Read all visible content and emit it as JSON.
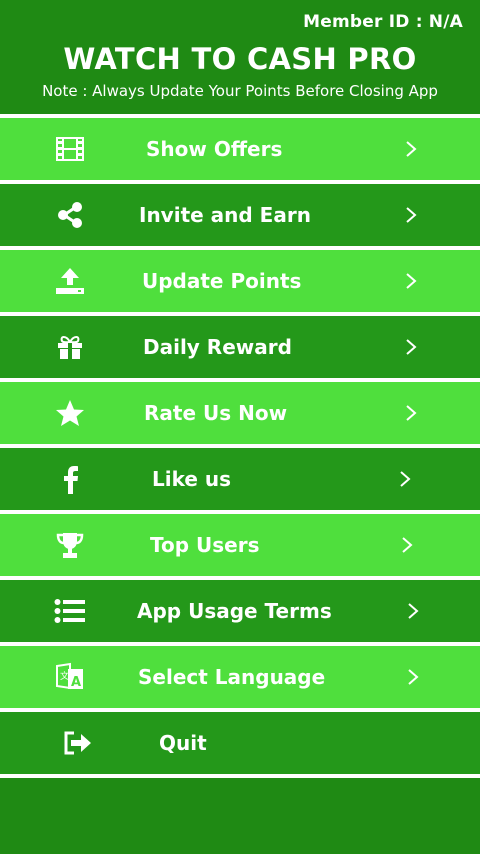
{
  "header": {
    "member_id": "Member ID : N/A",
    "title": "WATCH TO CASH PRO",
    "note": "Note : Always Update Your Points Before Closing App"
  },
  "colors": {
    "header_bg": "#1f8a14",
    "light_row": "#4fdf3d",
    "dark_row": "#24981a",
    "separator": "#ffffff"
  },
  "menu": {
    "items": [
      {
        "label": "Show Offers",
        "icon": "film-icon"
      },
      {
        "label": "Invite and Earn",
        "icon": "share-icon"
      },
      {
        "label": "Update Points",
        "icon": "upload-icon"
      },
      {
        "label": "Daily Reward",
        "icon": "gift-icon"
      },
      {
        "label": "Rate Us Now",
        "icon": "star-icon"
      },
      {
        "label": "Like us",
        "icon": "facebook-icon"
      },
      {
        "label": "Top Users",
        "icon": "trophy-icon"
      },
      {
        "label": "App Usage Terms",
        "icon": "list-icon"
      },
      {
        "label": "Select Language",
        "icon": "translate-icon"
      },
      {
        "label": "Quit",
        "icon": "exit-icon"
      }
    ]
  }
}
